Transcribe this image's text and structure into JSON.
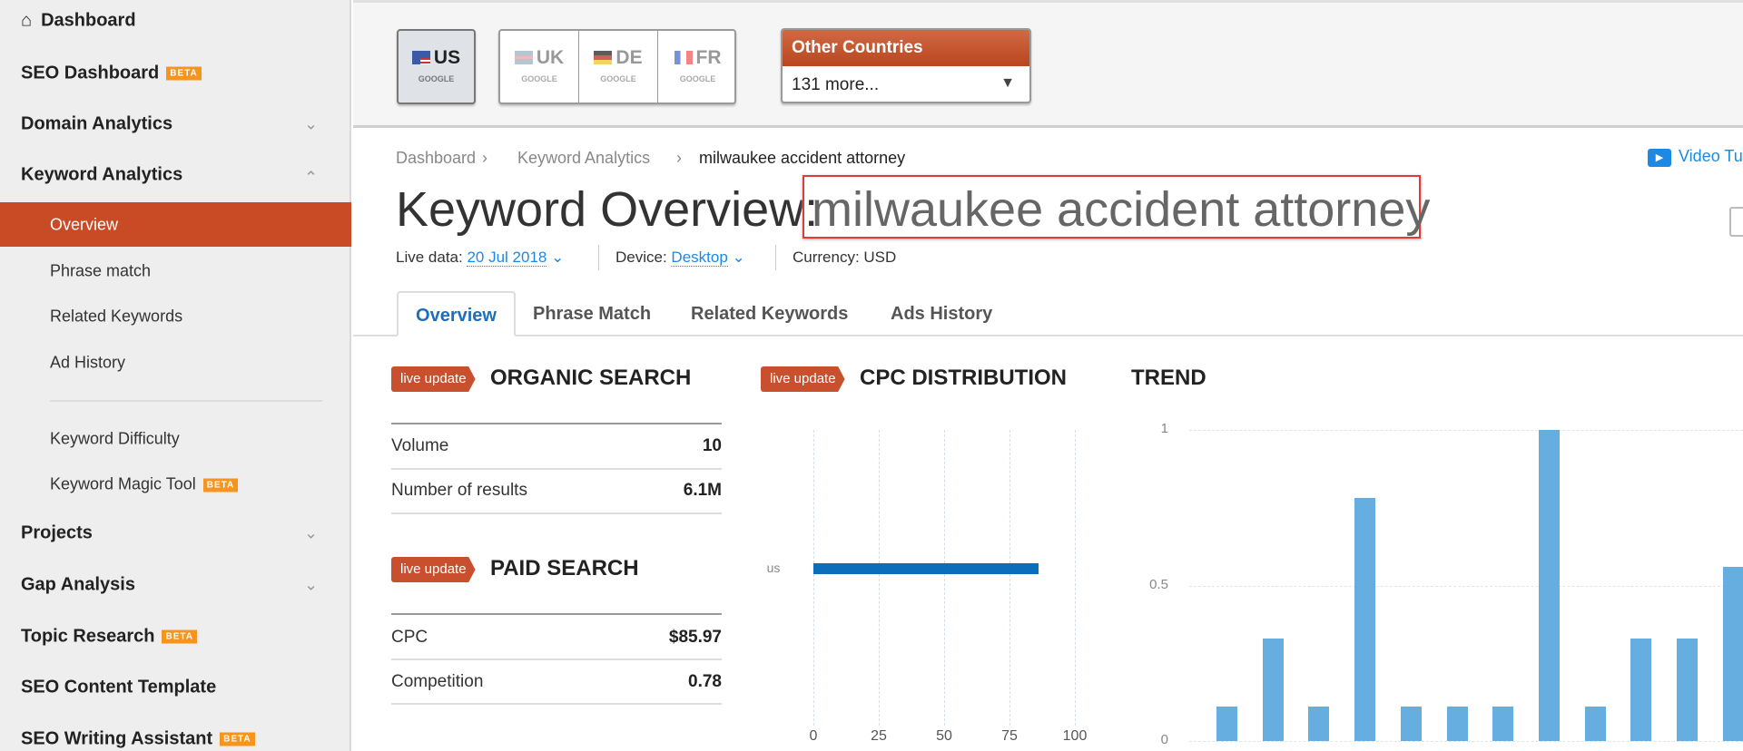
{
  "sidebar": {
    "items": [
      {
        "label": "Dashboard",
        "icon": "home-icon"
      },
      {
        "label": "SEO Dashboard",
        "badge": "BETA"
      },
      {
        "label": "Domain Analytics",
        "expanded": false
      },
      {
        "label": "Keyword Analytics",
        "expanded": true
      },
      {
        "label": "Overview",
        "active": true
      },
      {
        "label": "Phrase match"
      },
      {
        "label": "Related Keywords"
      },
      {
        "label": "Ad History"
      },
      {
        "label": "Keyword Difficulty"
      },
      {
        "label": "Keyword Magic Tool",
        "badge": "BETA"
      },
      {
        "label": "Projects",
        "expanded": false
      },
      {
        "label": "Gap Analysis",
        "expanded": false
      },
      {
        "label": "Topic Research",
        "badge": "BETA"
      },
      {
        "label": "SEO Content Template"
      },
      {
        "label": "SEO Writing Assistant",
        "badge": "BETA"
      }
    ]
  },
  "databases": {
    "selected": "US",
    "items": [
      {
        "code": "US",
        "engine": "GOOGLE"
      },
      {
        "code": "UK",
        "engine": "GOOGLE"
      },
      {
        "code": "DE",
        "engine": "GOOGLE"
      },
      {
        "code": "FR",
        "engine": "GOOGLE"
      }
    ],
    "other": {
      "title": "Other Countries",
      "value": "131 more..."
    }
  },
  "breadcrumb": [
    "Dashboard",
    "Keyword Analytics",
    "milwaukee accident attorney"
  ],
  "video_link": "Video Tu",
  "title": {
    "prefix": "Keyword Overview:",
    "keyword": "milwaukee accident attorney"
  },
  "meta": {
    "live_label": "Live data:",
    "live_value": "20 Jul 2018",
    "device_label": "Device:",
    "device_value": "Desktop",
    "currency": "Currency: USD"
  },
  "tabs": [
    "Overview",
    "Phrase Match",
    "Related Keywords",
    "Ads History"
  ],
  "badge_label": "live update",
  "organic": {
    "title": "ORGANIC SEARCH",
    "rows": [
      {
        "label": "Volume",
        "value": "10"
      },
      {
        "label": "Number of results",
        "value": "6.1M"
      }
    ]
  },
  "paid": {
    "title": "PAID SEARCH",
    "rows": [
      {
        "label": "CPC",
        "value": "$85.97"
      },
      {
        "label": "Competition",
        "value": "0.78"
      }
    ]
  },
  "colors": {
    "accent": "#c94b26",
    "link": "#1e88e5",
    "cpc_bar": "#0a6ebd",
    "trend_bar": "#67aee0",
    "beta": "#f7941d"
  },
  "chart_data": [
    {
      "type": "bar",
      "orientation": "horizontal",
      "title": "CPC DISTRIBUTION",
      "categories": [
        "us"
      ],
      "values": [
        85.97
      ],
      "xlim": [
        0,
        100
      ],
      "xticks": [
        "0",
        "25",
        "50",
        "75",
        "100"
      ],
      "grid": true
    },
    {
      "type": "bar",
      "title": "TREND",
      "values": [
        0.11,
        0.33,
        0.11,
        0.78,
        0.11,
        0.11,
        0.11,
        1,
        0.11,
        0.33,
        0.33,
        0.56
      ],
      "ylim": [
        0,
        1
      ],
      "yticks": [
        "1",
        "0.5",
        "0"
      ],
      "grid": true
    }
  ]
}
